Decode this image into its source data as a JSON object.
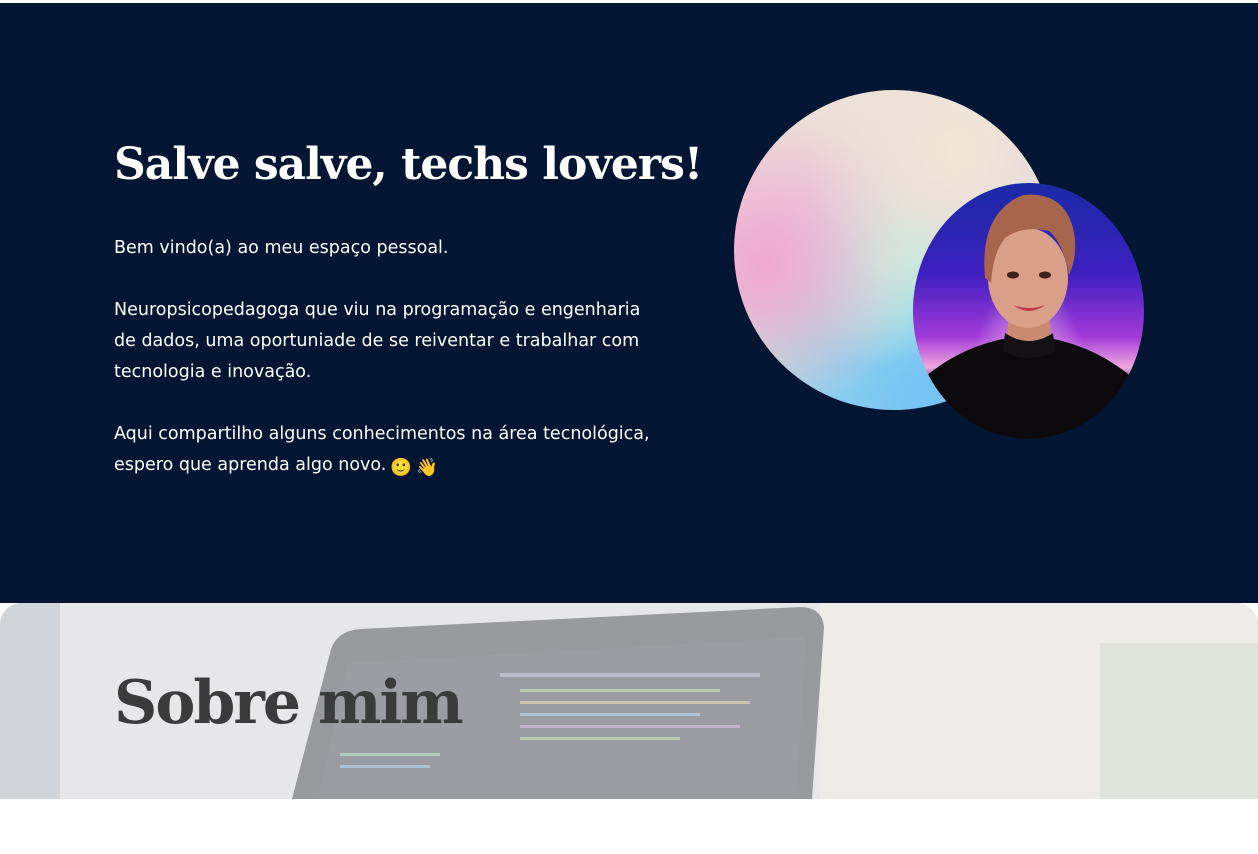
{
  "hero": {
    "title": "Salve salve, techs lovers!",
    "paragraphs": [
      "Bem vindo(a) ao meu espaço pessoal.",
      "Neuropsicopedagoga que viu na programação e engenharia de dados, uma oportuniade de se reiventar e trabalhar com tecnologia e inovação.",
      "Aqui compartilho alguns conhecimentos na área tecnológica, espero que aprenda algo novo."
    ],
    "emojis": [
      "🙂",
      "👋"
    ],
    "colors": {
      "background": "#021633",
      "text": "#ffffff"
    },
    "images": {
      "blob": "gradient-blob",
      "profile": "profile-photo"
    }
  },
  "about": {
    "title": "Sobre mim",
    "background_image": "laptop-code-photo",
    "colors": {
      "title": "#3b3b3b"
    }
  }
}
